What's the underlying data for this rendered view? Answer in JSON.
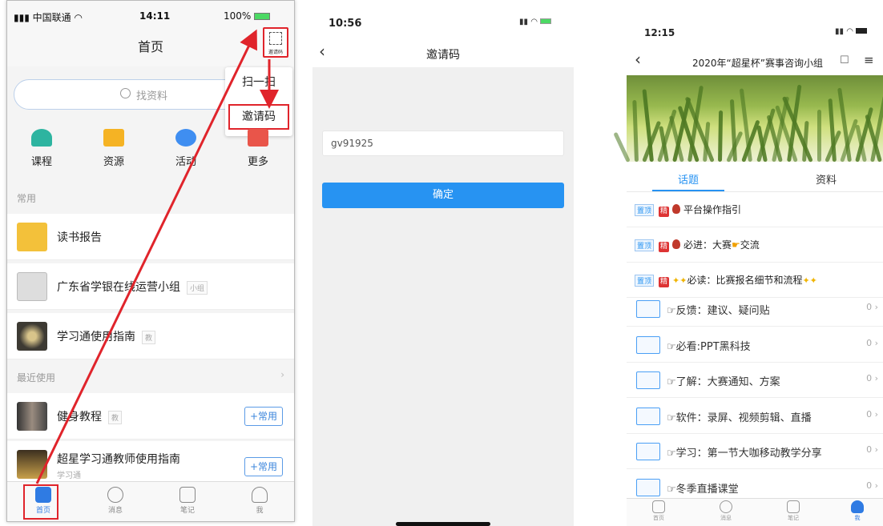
{
  "screen1": {
    "status": {
      "carrier": "中国联通",
      "time": "14:11",
      "battery": "100%"
    },
    "title": "首页",
    "scan_label": "邀请码",
    "search_placeholder": "找资料",
    "popup": {
      "item1": "扫一扫",
      "item2": "邀请码"
    },
    "grid": [
      {
        "label": "课程",
        "color": "#2db4a0"
      },
      {
        "label": "资源",
        "color": "#f5b324"
      },
      {
        "label": "活动",
        "color": "#3f8ef1"
      },
      {
        "label": "更多",
        "color": "#e9554a"
      }
    ],
    "section_common": "常用",
    "common": [
      {
        "name": "读书报告",
        "tag": ""
      },
      {
        "name": "广东省学银在线运营小组",
        "tag": "小组"
      },
      {
        "name": "学习通使用指南",
        "tag": "教"
      }
    ],
    "section_recent": "最近使用",
    "recent": [
      {
        "name": "健身教程",
        "tag": "教",
        "action": "+常用"
      },
      {
        "name": "超星学习通教师使用指南",
        "sub": "学习通",
        "action": "+常用"
      }
    ],
    "tabs": [
      "首页",
      "消息",
      "笔记",
      "我"
    ]
  },
  "screen2": {
    "time": "10:56",
    "title": "邀请码",
    "input_value": "gv91925",
    "confirm": "确定"
  },
  "screen3": {
    "time": "12:15",
    "title": "2020年“超星杯”赛事咨询小组",
    "tabs": [
      "话题",
      "资料"
    ],
    "pin_label": "置顶",
    "jing_label": "精",
    "pinned": [
      "平台操作指引",
      "必进：大赛",
      "交流",
      "必读：比赛报名细节和流程"
    ],
    "folders": [
      {
        "title": "☞反馈：建议、疑问贴",
        "count": "0"
      },
      {
        "title": "☞必看:PPT黑科技",
        "count": "0"
      },
      {
        "title": "☞了解：大赛通知、方案",
        "count": "0"
      },
      {
        "title": "☞软件：录屏、视频剪辑、直播",
        "count": "0"
      },
      {
        "title": "☞学习：第一节大咖移动教学分享",
        "count": "0"
      },
      {
        "title": "☞冬季直播课堂",
        "count": "0"
      }
    ],
    "bottom_tabs": [
      "首页",
      "消息",
      "笔记",
      "我"
    ]
  },
  "colors": {
    "accent": "#2793f2",
    "highlight": "#e0242b"
  }
}
